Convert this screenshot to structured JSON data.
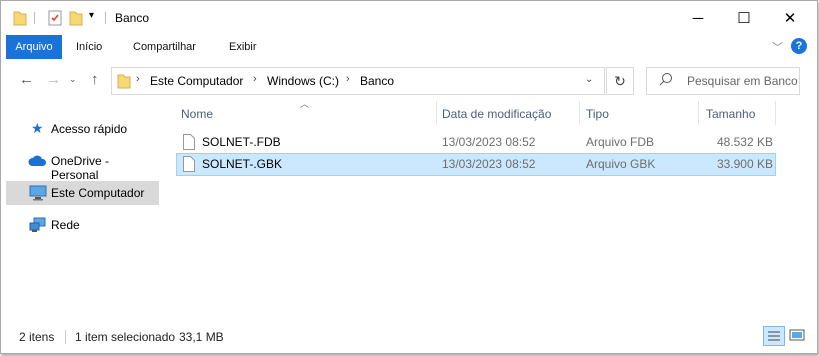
{
  "window": {
    "title": "Banco"
  },
  "controls": {
    "minimize": "─",
    "maximize": "☐",
    "close": "✕"
  },
  "ribbon": {
    "tabs": [
      "Arquivo",
      "Início",
      "Compartilhar",
      "Exibir"
    ],
    "expand_icon": "chevron-down-icon",
    "help_label": "?"
  },
  "address": {
    "crumbs": [
      "Este Computador",
      "Windows (C:)",
      "Banco"
    ],
    "search_placeholder": "Pesquisar em Banco"
  },
  "navpane": {
    "items": [
      {
        "label": "Acesso rápido",
        "icon": "star-icon"
      },
      {
        "label": "OneDrive - Personal",
        "icon": "cloud-icon"
      },
      {
        "label": "Este Computador",
        "icon": "computer-icon",
        "selected": true
      },
      {
        "label": "Rede",
        "icon": "network-icon"
      }
    ]
  },
  "columns": {
    "name": "Nome",
    "date": "Data de modificação",
    "type": "Tipo",
    "size": "Tamanho"
  },
  "files": [
    {
      "name": "SOLNET-.FDB",
      "date": "13/03/2023 08:52",
      "type": "Arquivo FDB",
      "size": "48.532 KB",
      "selected": false
    },
    {
      "name": "SOLNET-.GBK",
      "date": "13/03/2023 08:52",
      "type": "Arquivo GBK",
      "size": "33.900 KB",
      "selected": true
    }
  ],
  "status": {
    "count": "2 itens",
    "selected": "1 item selecionado",
    "size": "33,1 MB"
  },
  "colors": {
    "accent": "#1a73d9",
    "selection": "#cce8ff",
    "selection_border": "#99d1ff",
    "folder": "#f8d775"
  }
}
